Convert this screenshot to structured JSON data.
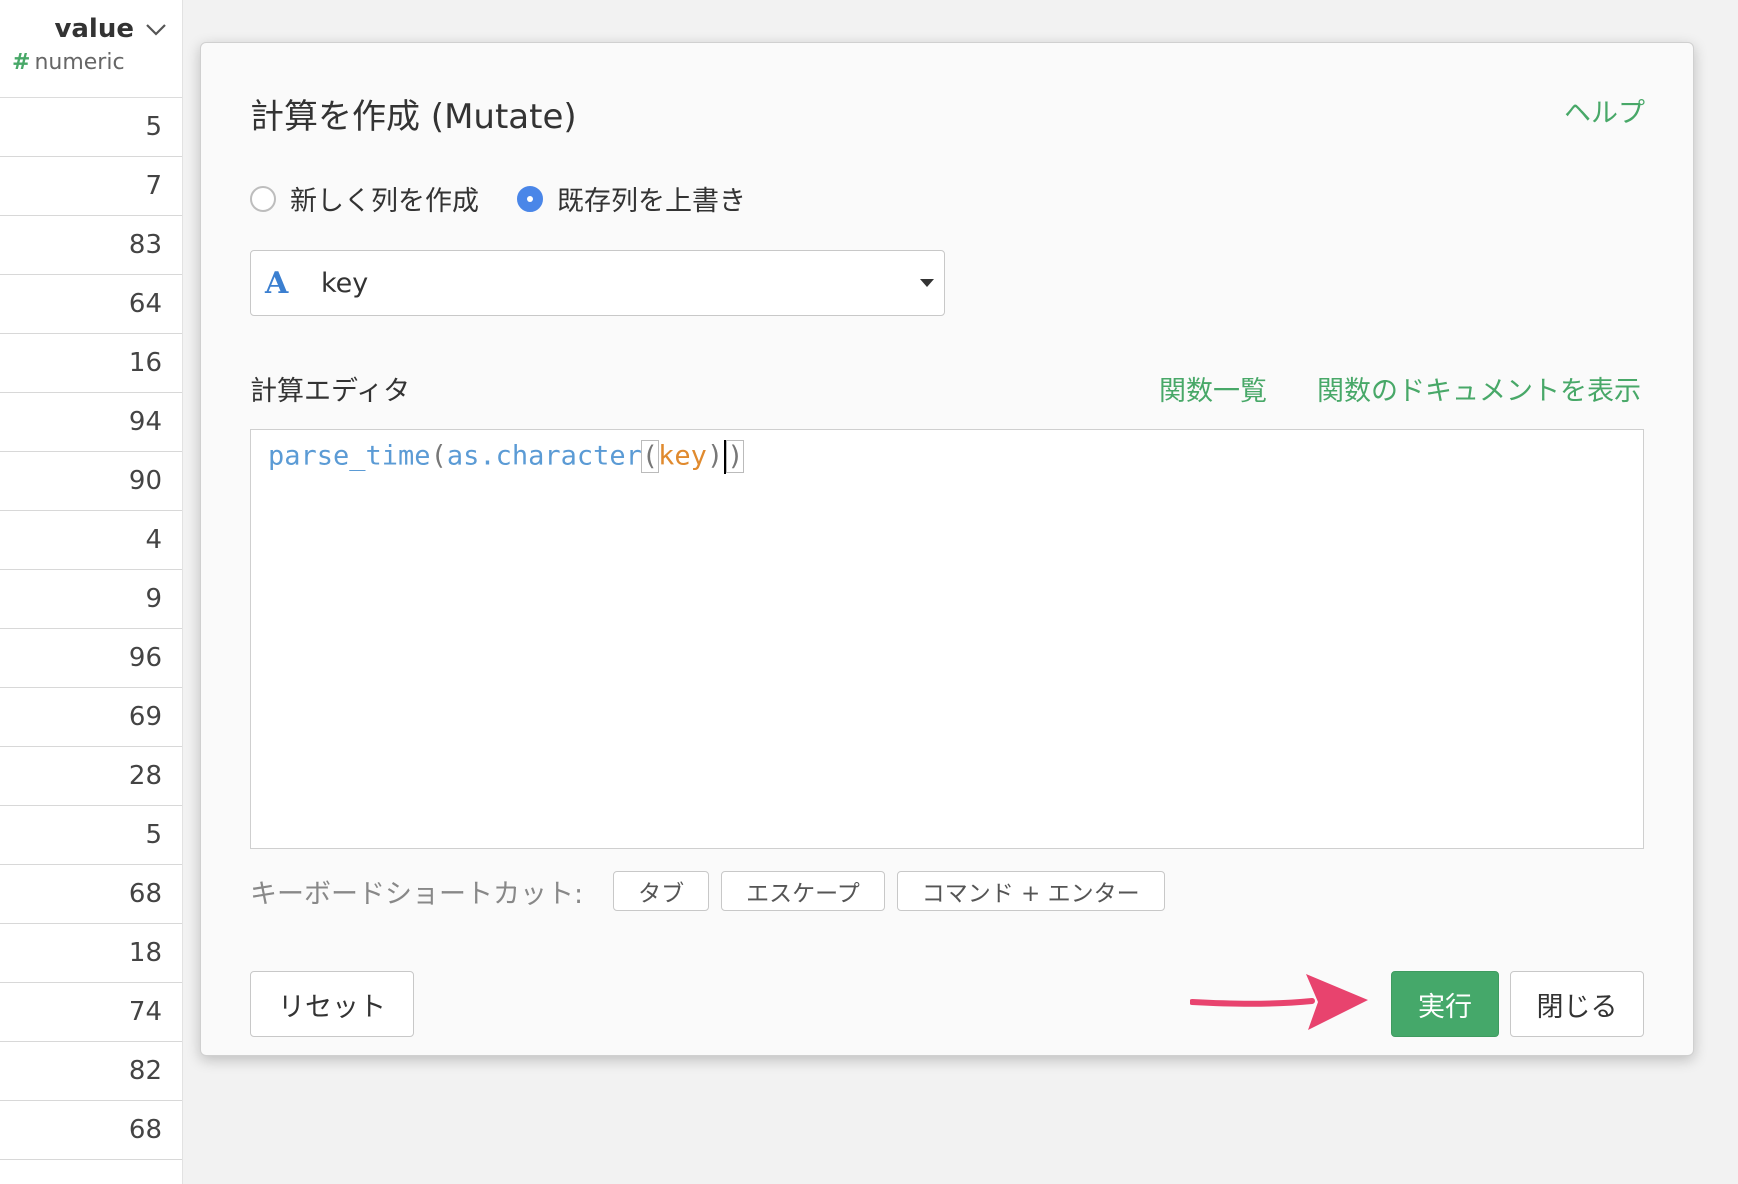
{
  "column": {
    "name": "value",
    "type_label": "numeric",
    "type_icon": "#",
    "values": [
      "5",
      "7",
      "83",
      "64",
      "16",
      "94",
      "90",
      "4",
      "9",
      "96",
      "69",
      "28",
      "5",
      "68",
      "18",
      "74",
      "82",
      "68"
    ]
  },
  "dialog": {
    "title": "計算を作成 (Mutate)",
    "help_link": "ヘルプ",
    "radio_new": "新しく列を作成",
    "radio_overwrite": "既存列を上書き",
    "selected_mode": "overwrite",
    "column_select": {
      "type_icon": "A",
      "value": "key"
    },
    "editor_label": "計算エディタ",
    "function_list_link": "関数一覧",
    "function_docs_link": "関数のドキュメントを表示",
    "code": {
      "fn1": "parse_time",
      "open1": "(",
      "fn2": "as.character",
      "open2": "(",
      "arg": "key",
      "close2": ")",
      "close1": ")"
    },
    "shortcuts": {
      "label": "キーボードショートカット:",
      "keys": [
        "タブ",
        "エスケープ",
        "コマンド + エンター"
      ]
    },
    "buttons": {
      "reset": "リセット",
      "run": "実行",
      "close": "閉じる"
    }
  },
  "colors": {
    "accent_green": "#48a868",
    "primary_button": "#45a86a",
    "radio_selected": "#4a86e8",
    "annotation_arrow": "#e8436e"
  }
}
